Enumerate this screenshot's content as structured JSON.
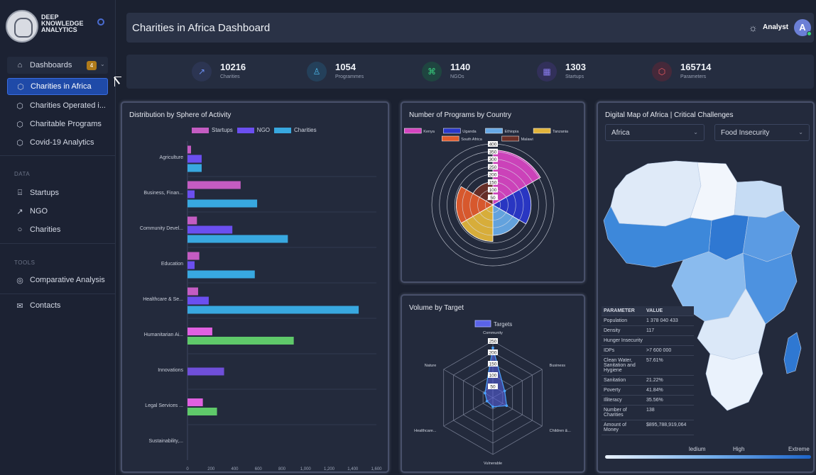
{
  "brand": {
    "line1": "DEEP",
    "line2": "KNOWLEDGE",
    "line3": "ANALYTICS"
  },
  "nav": {
    "dashboards": {
      "label": "Dashboards",
      "badge": "4"
    },
    "items": [
      {
        "label": "Charities in Africa",
        "active": true
      },
      {
        "label": "Charities Operated i..."
      },
      {
        "label": "Charitable Programs"
      },
      {
        "label": "Covid-19 Analytics"
      }
    ],
    "data_section": "DATA",
    "data_items": [
      {
        "label": "Startups"
      },
      {
        "label": "NGO"
      },
      {
        "label": "Charities"
      }
    ],
    "tools_section": "TOOLS",
    "tools_items": [
      {
        "label": "Comparative Analysis"
      }
    ],
    "contacts": "Contacts"
  },
  "header": {
    "title": "Charities in Africa Dashboard",
    "user_role": "Analyst",
    "avatar_initial": "A"
  },
  "stats": [
    {
      "value": "10216",
      "label": "Charities",
      "icon": "trend-icon",
      "color": "#3b5bdb"
    },
    {
      "value": "1054",
      "label": "Programmes",
      "icon": "user-icon",
      "color": "#3aa7d8"
    },
    {
      "value": "1140",
      "label": "NGOs",
      "icon": "command-icon",
      "color": "#2fbf71"
    },
    {
      "value": "1303",
      "label": "Startups",
      "icon": "grid-icon",
      "color": "#6b5bd8"
    },
    {
      "value": "165714",
      "label": "Parameters",
      "icon": "cube-icon",
      "color": "#e0484f"
    }
  ],
  "panels": {
    "distribution": {
      "title": "Distribution by Sphere of Activity"
    },
    "programs": {
      "title": "Number of Programs by Country"
    },
    "volume": {
      "title": "Volume by Target"
    },
    "map": {
      "title": "Digital Map of Africa | Critical Challenges",
      "region_select": "Africa",
      "challenge_select": "Food Insecurity",
      "table_header": {
        "param": "PARAMETER",
        "value": "VALUE"
      },
      "table_rows": [
        {
          "param": "Population",
          "value": "1 378 040 433"
        },
        {
          "param": "Density",
          "value": "117"
        },
        {
          "param": "Hunger Insecurity",
          "value": ""
        },
        {
          "param": "IDPs",
          "value": ">7 600 000"
        },
        {
          "param": "Clean Water, Sanitation and Hygiene",
          "value": "57.61%"
        },
        {
          "param": "Sanitation",
          "value": "21.22%"
        },
        {
          "param": "Poverty",
          "value": "41.84%"
        },
        {
          "param": "Illiteracy",
          "value": "35.56%"
        },
        {
          "param": "Number of Charities",
          "value": "138"
        },
        {
          "param": "Amount of Money",
          "value": "$895,788,919,064"
        }
      ],
      "scale_labels": [
        "ledium",
        "High",
        "Extreme"
      ],
      "scale_colors": [
        "#e9f1fb",
        "#78b1ec",
        "#1d64c9"
      ]
    }
  },
  "chart_data": [
    {
      "type": "bar",
      "orientation": "horizontal",
      "title": "Distribution by Sphere of Activity",
      "categories": [
        "Agriculture",
        "Business, Finan...",
        "Community Devel...",
        "Education",
        "Healthcare & Se...",
        "Humanitarian Ai...",
        "Innovations",
        "Legal Services ...",
        "Sustainability,..."
      ],
      "series": [
        {
          "name": "Startups",
          "color": "#c45cc2",
          "values": [
            30,
            450,
            80,
            100,
            90,
            0,
            0,
            0,
            0
          ]
        },
        {
          "name": "NGO",
          "color": "#6b4ff0",
          "values": [
            120,
            60,
            380,
            60,
            180,
            210,
            310,
            10,
            0
          ]
        },
        {
          "name": "Charities",
          "color": "#38a8e0",
          "values": [
            120,
            590,
            850,
            570,
            1450,
            0,
            0,
            0,
            0
          ]
        }
      ],
      "extra_series_colors": {
        "Humanitarian Ai...": [
          "#e060e0",
          "#5fc96a"
        ],
        "Legal Services ...": [
          "#e060e0",
          "#5fc96a"
        ]
      },
      "extra_values": {
        "Humanitarian Ai...": [
          210,
          900
        ],
        "Legal Services ...": [
          130,
          250
        ],
        "Innovations": [
          310
        ]
      },
      "xticks": [
        "0",
        "200",
        "400",
        "600",
        "800",
        "1,000",
        "1,200",
        "1,400",
        "1,600"
      ],
      "xlim": [
        0,
        1600
      ]
    },
    {
      "type": "polar-area",
      "title": "Number of Programs by Country",
      "categories": [
        "Kenya",
        "Uganda",
        "Ethiopia",
        "Tanzania",
        "South Africa",
        "Malawi"
      ],
      "colors": [
        "#d543c0",
        "#2a37c9",
        "#67a9e6",
        "#e2b43a",
        "#e25b2c",
        "#6a2e26"
      ],
      "values": [
        360,
        250,
        200,
        240,
        240,
        150
      ],
      "rticks": [
        "50",
        "100",
        "150",
        "200",
        "250",
        "300",
        "350",
        "400"
      ],
      "rlim": [
        0,
        400
      ]
    },
    {
      "type": "radar",
      "title": "Volume by Target",
      "categories": [
        "Community",
        "Business",
        "Children &...",
        "Vulnerable",
        "Healthcare...",
        "Nature"
      ],
      "series": [
        {
          "name": "Targets",
          "color": "#5a63e8",
          "values": [
            220,
            60,
            70,
            40,
            30,
            40
          ]
        }
      ],
      "rticks": [
        "50",
        "100",
        "150",
        "200",
        "250"
      ],
      "rlim": [
        0,
        250
      ]
    }
  ]
}
